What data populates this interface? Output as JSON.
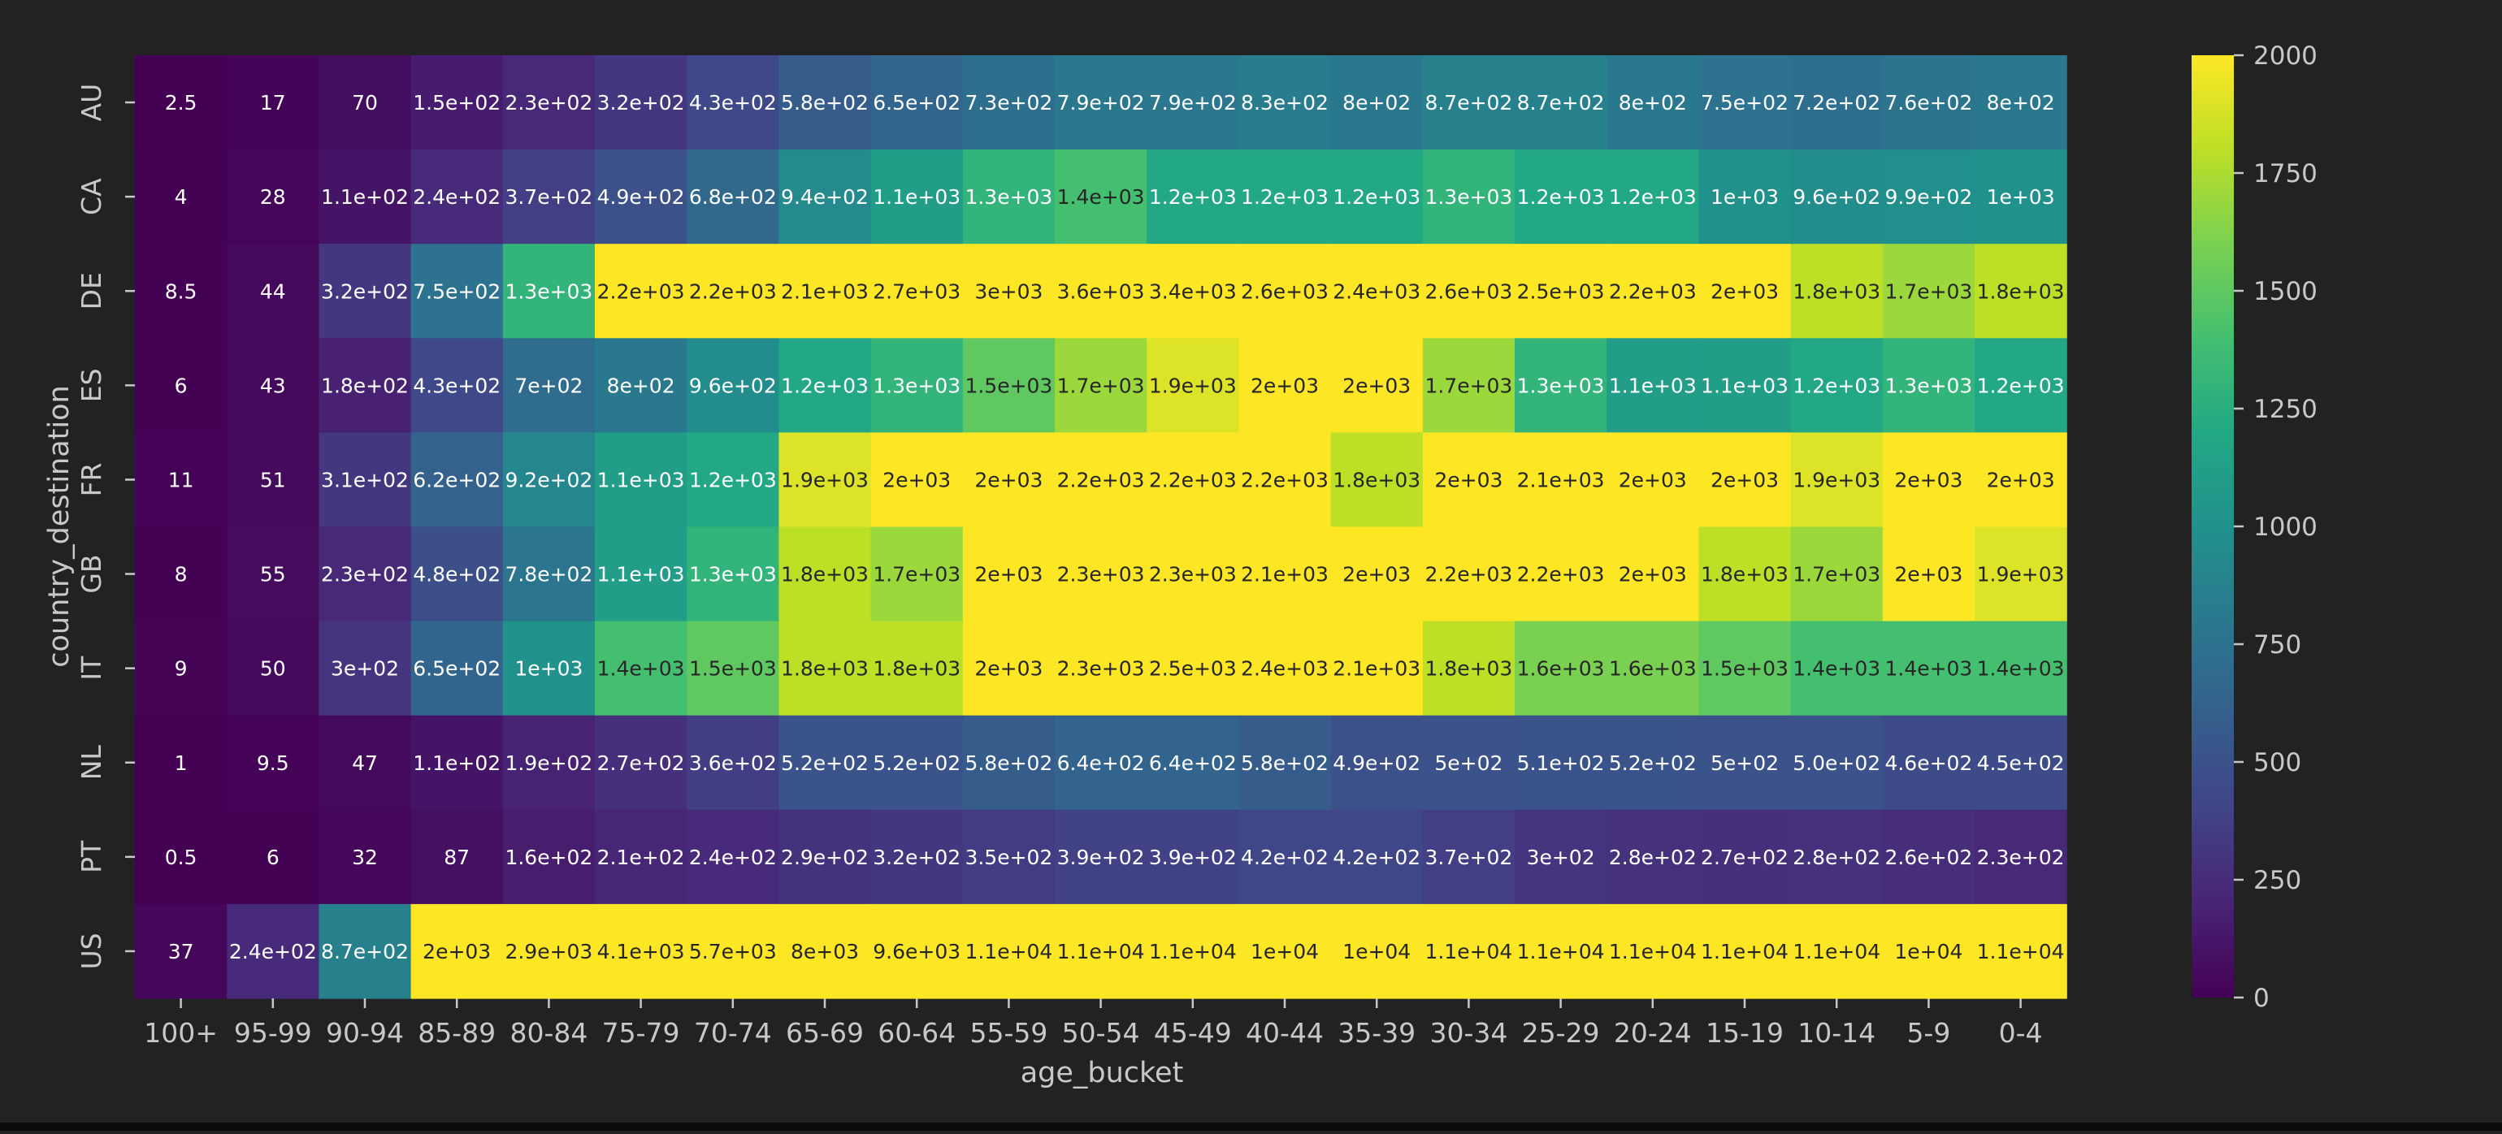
{
  "chart_data": {
    "type": "heatmap",
    "xlabel": "age_bucket",
    "ylabel": "country_destination",
    "x_categories": [
      "100+",
      "95-99",
      "90-94",
      "85-89",
      "80-84",
      "75-79",
      "70-74",
      "65-69",
      "60-64",
      "55-59",
      "50-54",
      "45-49",
      "40-44",
      "35-39",
      "30-34",
      "25-29",
      "20-24",
      "15-19",
      "10-14",
      "5-9",
      "0-4"
    ],
    "y_categories": [
      "AU",
      "CA",
      "DE",
      "ES",
      "FR",
      "GB",
      "IT",
      "NL",
      "PT",
      "US"
    ],
    "values": [
      [
        2.5,
        17,
        70,
        150,
        230,
        320,
        430,
        580,
        650,
        730,
        790,
        790,
        830,
        800,
        870,
        870,
        800,
        750,
        720,
        760,
        800
      ],
      [
        4,
        28,
        110,
        240,
        370,
        490,
        680,
        940,
        1100,
        1300,
        1400,
        1200,
        1200,
        1200,
        1300,
        1200,
        1200,
        1000,
        960,
        990,
        1000
      ],
      [
        8.5,
        44,
        320,
        750,
        1300,
        2200,
        2200,
        2100,
        2700,
        3000,
        3600,
        3400,
        2600,
        2400,
        2600,
        2500,
        2200,
        2000,
        1800,
        1700,
        1800
      ],
      [
        6,
        43,
        180,
        430,
        700,
        800,
        960,
        1200,
        1300,
        1500,
        1700,
        1900,
        2000,
        2000,
        1700,
        1300,
        1100,
        1100,
        1200,
        1300,
        1200
      ],
      [
        11,
        51,
        310,
        620,
        920,
        1100,
        1200,
        1900,
        2000,
        2000,
        2200,
        2200,
        2200,
        1800,
        2000,
        2100,
        2000,
        2000,
        1900,
        2000,
        2000
      ],
      [
        8,
        55,
        230,
        480,
        780,
        1100,
        1300,
        1800,
        1700,
        2000,
        2300,
        2300,
        2100,
        2000,
        2200,
        2200,
        2000,
        1800,
        1700,
        2000,
        1900
      ],
      [
        9,
        50,
        300,
        650,
        1000,
        1400,
        1500,
        1800,
        1800,
        2000,
        2300,
        2500,
        2400,
        2100,
        1800,
        1600,
        1600,
        1500,
        1400,
        1400,
        1400
      ],
      [
        1,
        9.5,
        47,
        110,
        190,
        270,
        360,
        520,
        520,
        580,
        640,
        640,
        580,
        490,
        500,
        510,
        520,
        500,
        500,
        460,
        450
      ],
      [
        0.5,
        6,
        32,
        87,
        160,
        210,
        240,
        290,
        320,
        350,
        390,
        390,
        420,
        420,
        370,
        300,
        280,
        270,
        280,
        260,
        230
      ],
      [
        37,
        240,
        870,
        2000,
        2900,
        4100,
        5700,
        8000,
        9600,
        11000,
        11000,
        11000,
        10000,
        10000,
        11000,
        11000,
        11000,
        11000,
        11000,
        10000,
        11000
      ]
    ],
    "labels": [
      [
        "2.5",
        "17",
        "70",
        "1.5e+02",
        "2.3e+02",
        "3.2e+02",
        "4.3e+02",
        "5.8e+02",
        "6.5e+02",
        "7.3e+02",
        "7.9e+02",
        "7.9e+02",
        "8.3e+02",
        "8e+02",
        "8.7e+02",
        "8.7e+02",
        "8e+02",
        "7.5e+02",
        "7.2e+02",
        "7.6e+02",
        "8e+02"
      ],
      [
        "4",
        "28",
        "1.1e+02",
        "2.4e+02",
        "3.7e+02",
        "4.9e+02",
        "6.8e+02",
        "9.4e+02",
        "1.1e+03",
        "1.3e+03",
        "1.4e+03",
        "1.2e+03",
        "1.2e+03",
        "1.2e+03",
        "1.3e+03",
        "1.2e+03",
        "1.2e+03",
        "1e+03",
        "9.6e+02",
        "9.9e+02",
        "1e+03"
      ],
      [
        "8.5",
        "44",
        "3.2e+02",
        "7.5e+02",
        "1.3e+03",
        "2.2e+03",
        "2.2e+03",
        "2.1e+03",
        "2.7e+03",
        "3e+03",
        "3.6e+03",
        "3.4e+03",
        "2.6e+03",
        "2.4e+03",
        "2.6e+03",
        "2.5e+03",
        "2.2e+03",
        "2e+03",
        "1.8e+03",
        "1.7e+03",
        "1.8e+03"
      ],
      [
        "6",
        "43",
        "1.8e+02",
        "4.3e+02",
        "7e+02",
        "8e+02",
        "9.6e+02",
        "1.2e+03",
        "1.3e+03",
        "1.5e+03",
        "1.7e+03",
        "1.9e+03",
        "2e+03",
        "2e+03",
        "1.7e+03",
        "1.3e+03",
        "1.1e+03",
        "1.1e+03",
        "1.2e+03",
        "1.3e+03",
        "1.2e+03"
      ],
      [
        "11",
        "51",
        "3.1e+02",
        "6.2e+02",
        "9.2e+02",
        "1.1e+03",
        "1.2e+03",
        "1.9e+03",
        "2e+03",
        "2e+03",
        "2.2e+03",
        "2.2e+03",
        "2.2e+03",
        "1.8e+03",
        "2e+03",
        "2.1e+03",
        "2e+03",
        "2e+03",
        "1.9e+03",
        "2e+03",
        "2e+03"
      ],
      [
        "8",
        "55",
        "2.3e+02",
        "4.8e+02",
        "7.8e+02",
        "1.1e+03",
        "1.3e+03",
        "1.8e+03",
        "1.7e+03",
        "2e+03",
        "2.3e+03",
        "2.3e+03",
        "2.1e+03",
        "2e+03",
        "2.2e+03",
        "2.2e+03",
        "2e+03",
        "1.8e+03",
        "1.7e+03",
        "2e+03",
        "1.9e+03"
      ],
      [
        "9",
        "50",
        "3e+02",
        "6.5e+02",
        "1e+03",
        "1.4e+03",
        "1.5e+03",
        "1.8e+03",
        "1.8e+03",
        "2e+03",
        "2.3e+03",
        "2.5e+03",
        "2.4e+03",
        "2.1e+03",
        "1.8e+03",
        "1.6e+03",
        "1.6e+03",
        "1.5e+03",
        "1.4e+03",
        "1.4e+03",
        "1.4e+03"
      ],
      [
        "1",
        "9.5",
        "47",
        "1.1e+02",
        "1.9e+02",
        "2.7e+02",
        "3.6e+02",
        "5.2e+02",
        "5.2e+02",
        "5.8e+02",
        "6.4e+02",
        "6.4e+02",
        "5.8e+02",
        "4.9e+02",
        "5e+02",
        "5.1e+02",
        "5.2e+02",
        "5e+02",
        "5.0e+02",
        "4.6e+02",
        "4.5e+02"
      ],
      [
        "0.5",
        "6",
        "32",
        "87",
        "1.6e+02",
        "2.1e+02",
        "2.4e+02",
        "2.9e+02",
        "3.2e+02",
        "3.5e+02",
        "3.9e+02",
        "3.9e+02",
        "4.2e+02",
        "4.2e+02",
        "3.7e+02",
        "3e+02",
        "2.8e+02",
        "2.7e+02",
        "2.8e+02",
        "2.6e+02",
        "2.3e+02"
      ],
      [
        "37",
        "2.4e+02",
        "8.7e+02",
        "2e+03",
        "2.9e+03",
        "4.1e+03",
        "5.7e+03",
        "8e+03",
        "9.6e+03",
        "1.1e+04",
        "1.1e+04",
        "1.1e+04",
        "1e+04",
        "1e+04",
        "1.1e+04",
        "1.1e+04",
        "1.1e+04",
        "1.1e+04",
        "1.1e+04",
        "1e+04",
        "1.1e+04"
      ]
    ],
    "colorbar": {
      "range": [
        0,
        2000
      ],
      "ticks": [
        0,
        250,
        500,
        750,
        1000,
        1250,
        1500,
        1750,
        2000
      ],
      "colormap": "viridis"
    },
    "grid": false,
    "colors": {
      "background": "#222222",
      "text": "#c8c8c8"
    }
  }
}
